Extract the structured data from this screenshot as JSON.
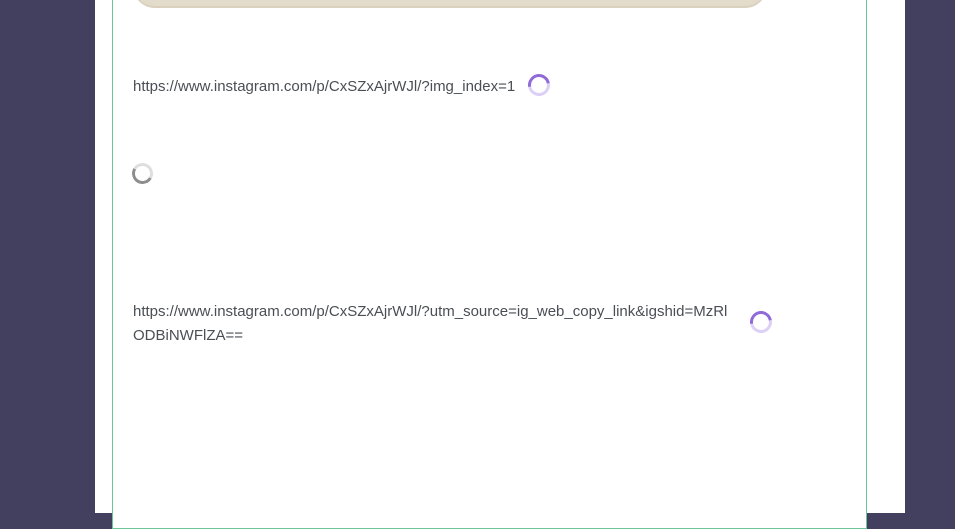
{
  "colors": {
    "backdrop": "#43405f",
    "panel_border": "#6cc59a",
    "text": "#4a4f55",
    "spinner_accent": "#8f6ad8",
    "spinner_neutral": "#8d8d8d"
  },
  "feed": {
    "items": [
      {
        "link": "https://www.instagram.com/p/CxSZxAjrWJl/?img_index=1",
        "status_icon": "loading-spinner-icon"
      },
      {
        "status_icon": "loading-spinner-icon"
      },
      {
        "link": "https://www.instagram.com/p/CxSZxAjrWJl/?utm_source=ig_web_copy_link&igshid=MzRlODBiNWFlZA==",
        "status_icon": "loading-spinner-icon"
      }
    ]
  }
}
